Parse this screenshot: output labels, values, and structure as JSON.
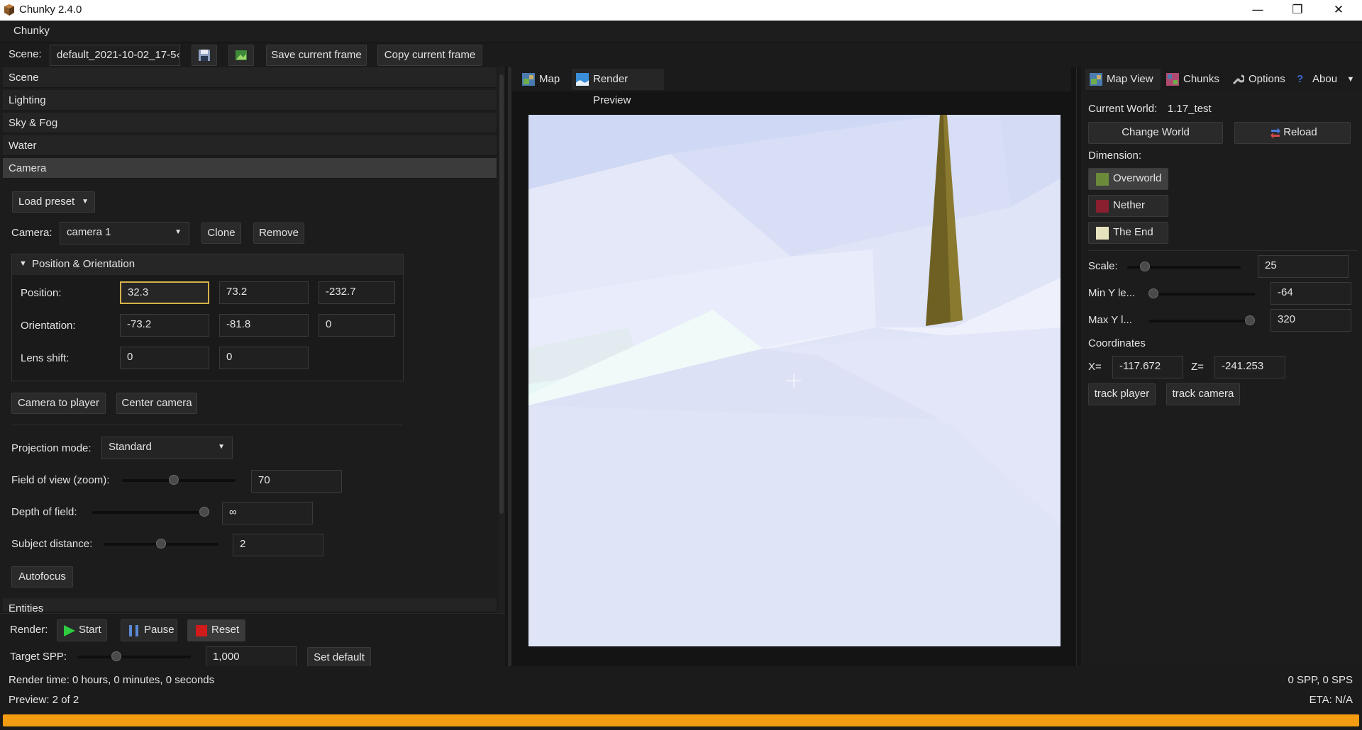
{
  "window": {
    "title": "Chunky 2.4.0",
    "minimize": "—",
    "maximize": "❐",
    "close": "✕"
  },
  "menubar": {
    "menu": "Chunky"
  },
  "toolbar": {
    "scene_label": "Scene:",
    "scene_value": "default_2021-10-02_17-5‹",
    "save_frame": "Save current frame",
    "copy_frame": "Copy current frame"
  },
  "left": {
    "sections": [
      "Scene",
      "Lighting",
      "Sky & Fog",
      "Water",
      "Camera"
    ],
    "load_preset": "Load preset",
    "camera_label": "Camera:",
    "camera_value": "camera 1",
    "clone": "Clone",
    "remove": "Remove",
    "pos_orient_title": "Position & Orientation",
    "position_label": "Position:",
    "position": [
      "32.3",
      "73.2",
      "-232.7"
    ],
    "orientation_label": "Orientation:",
    "orientation": [
      "-73.2",
      "-81.8",
      "0"
    ],
    "lens_shift_label": "Lens shift:",
    "lens_shift": [
      "0",
      "0"
    ],
    "camera_to_player": "Camera to player",
    "center_camera": "Center camera",
    "projection_label": "Projection mode:",
    "projection_value": "Standard",
    "fov_label": "Field of view (zoom):",
    "fov_value": "70",
    "fov_slider": 0.45,
    "dof_label": "Depth of field:",
    "dof_value": "∞",
    "dof_slider": 1.0,
    "subject_label": "Subject distance:",
    "subject_value": "2",
    "subject_slider": 0.5,
    "autofocus": "Autofocus",
    "entities": "Entities",
    "render_label": "Render:",
    "start": "Start",
    "pause": "Pause",
    "reset": "Reset",
    "spp_label": "Target SPP:",
    "spp_value": "1,000",
    "spp_slider": 0.33,
    "set_default": "Set default"
  },
  "center": {
    "tabs": [
      "Map",
      "Render Preview"
    ]
  },
  "right": {
    "tabs": [
      "Map View",
      "Chunks",
      "Options",
      "Abou"
    ],
    "current_world_label": "Current World:",
    "current_world": "1.17_test",
    "change_world": "Change World",
    "reload": "Reload",
    "dimension_label": "Dimension:",
    "dimensions": [
      "Overworld",
      "Nether",
      "The End"
    ],
    "scale_label": "Scale:",
    "scale_value": "25",
    "scale_slider": 0.12,
    "miny_label": "Min Y le...",
    "miny_value": "-64",
    "miny_slider": 0.0,
    "maxy_label": "Max Y l...",
    "maxy_value": "320",
    "maxy_slider": 1.0,
    "coords_label": "Coordinates",
    "x_label": "X=",
    "x_value": "-117.672",
    "z_label": "Z=",
    "z_value": "-241.253",
    "track_player": "track player",
    "track_camera": "track camera"
  },
  "status": {
    "render_time": "Render time: 0 hours, 0 minutes, 0 seconds",
    "preview": "Preview: 2 of 2",
    "sps": "0 SPP, 0 SPS",
    "eta": "ETA: N/A",
    "progress": 1.0
  },
  "colors": {
    "progress": "#f39c12",
    "sky": "#dfe4f7",
    "accent_focus": "#d4b24a"
  }
}
